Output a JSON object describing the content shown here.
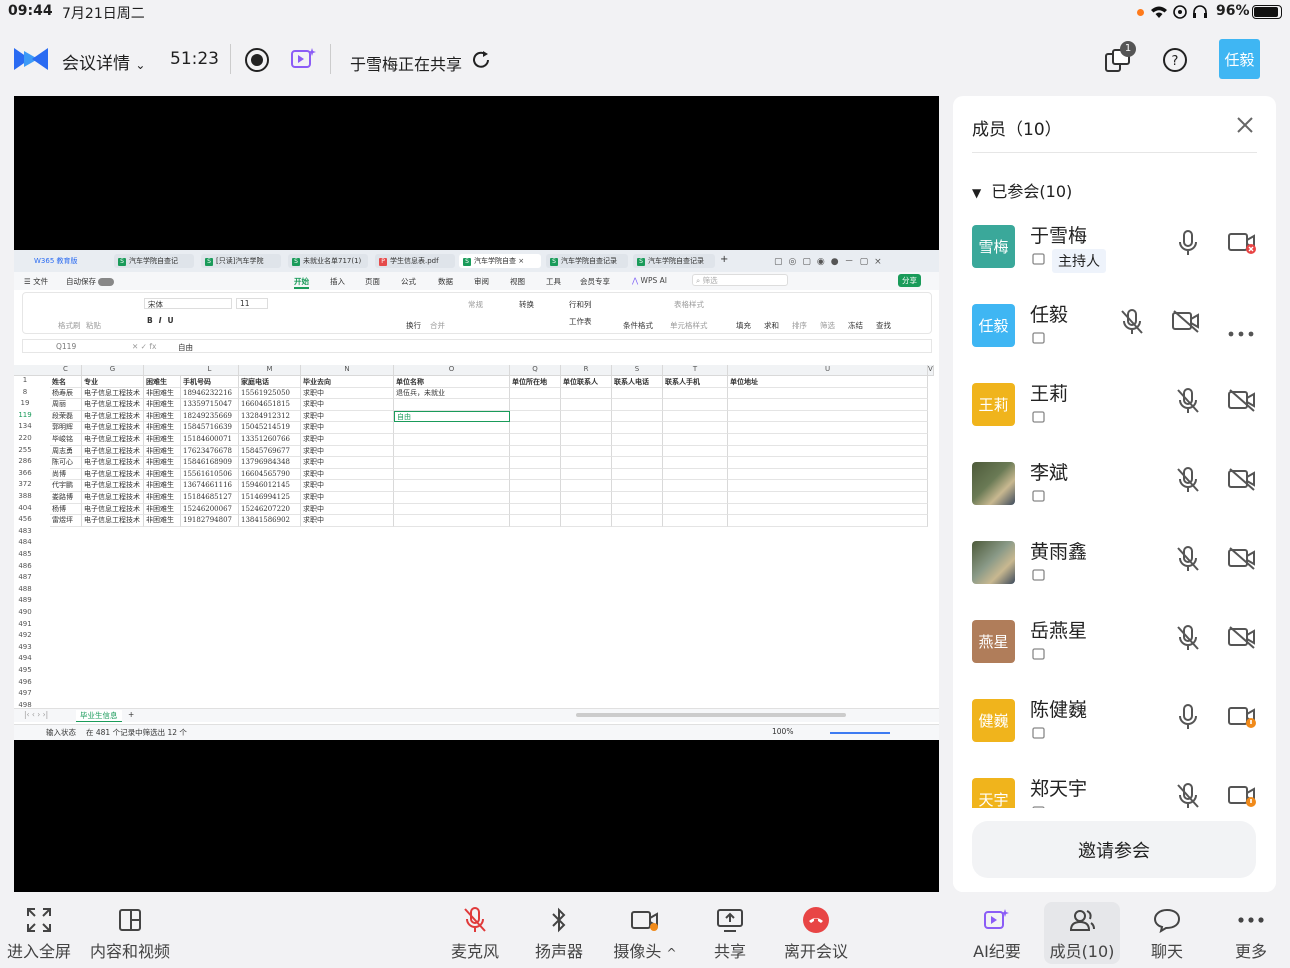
{
  "status_bar": {
    "time": "09:44",
    "date": "7月21日周二",
    "battery": "96%"
  },
  "topbar": {
    "meeting_details": "会议详情",
    "timer": "51:23",
    "sharing_text": "于雪梅正在共享",
    "layout_badge": "1",
    "user_avatar": "任毅",
    "colors": {
      "brand": "#2a6bf2",
      "avatar": "#3fb6f3",
      "purple": "#8b5cf6"
    }
  },
  "excel": {
    "tabs": [
      "W365 教育版",
      "汽车学院自查记",
      "[只读]汽车学院",
      "未就业名单717(1)",
      "学生信息表.pdf",
      "汽车学院自查",
      "汽车学院自查记录",
      "汽车学院自查记录"
    ],
    "menu": [
      "文件",
      "自动保存",
      "开始",
      "插入",
      "页面",
      "公式",
      "数据",
      "审阅",
      "视图",
      "工具",
      "会员专享",
      "WPS AI",
      "筛选",
      "分享"
    ],
    "ribbon": [
      "格式刷",
      "粘贴",
      "宋体",
      "11",
      "换行",
      "合并",
      "常规",
      "转换",
      "行和列",
      "工作表",
      "条件格式",
      "单元格样式",
      "表格样式",
      "填充",
      "求和",
      "排序",
      "筛选",
      "冻结",
      "查找"
    ],
    "name_box": "Q119",
    "formula": "自由",
    "col_letters": [
      "C",
      "G",
      "L",
      "M",
      "N",
      "O",
      "Q",
      "R",
      "S",
      "T",
      "U",
      "V"
    ],
    "headers": [
      "姓名",
      "专业",
      "困难生",
      "手机号码",
      "家庭电话",
      "毕业去向",
      "单位名称",
      "单位所在地",
      "单位联系人",
      "联系人电话",
      "联系人手机",
      "单位地址"
    ],
    "rows": [
      {
        "n": "1",
        "c": []
      },
      {
        "n": "8",
        "c": [
          "杨寿辰",
          "电子信息工程技术",
          "非困难生",
          "18946232216",
          "15561925050",
          "求职中",
          "退伍兵，未就业"
        ]
      },
      {
        "n": "19",
        "c": [
          "周丽",
          "电子信息工程技术",
          "非困难生",
          "13359715047",
          "16604651815",
          "求职中",
          ""
        ]
      },
      {
        "n": "119",
        "c": [
          "段荣磊",
          "电子信息工程技术",
          "非困难生",
          "18249235669",
          "13284912312",
          "求职中",
          "自由"
        ]
      },
      {
        "n": "134",
        "c": [
          "郭明辉",
          "电子信息工程技术",
          "非困难生",
          "15845716639",
          "15045214519",
          "求职中",
          ""
        ]
      },
      {
        "n": "220",
        "c": [
          "毕峻铭",
          "电子信息工程技术",
          "非困难生",
          "15184600071",
          "13351260766",
          "求职中",
          ""
        ]
      },
      {
        "n": "255",
        "c": [
          "周志勇",
          "电子信息工程技术",
          "非困难生",
          "17623476678",
          "15845769677",
          "求职中",
          ""
        ]
      },
      {
        "n": "286",
        "c": [
          "陈可心",
          "电子信息工程技术",
          "非困难生",
          "15846168909",
          "13796984348",
          "求职中",
          ""
        ]
      },
      {
        "n": "366",
        "c": [
          "尚博",
          "电子信息工程技术",
          "非困难生",
          "15561610506",
          "16604565790",
          "求职中",
          ""
        ]
      },
      {
        "n": "372",
        "c": [
          "代宇鹏",
          "电子信息工程技术",
          "非困难生",
          "13674661116",
          "15946012145",
          "求职中",
          ""
        ]
      },
      {
        "n": "388",
        "c": [
          "娄路博",
          "电子信息工程技术",
          "非困难生",
          "15184685127",
          "15146994125",
          "求职中",
          ""
        ]
      },
      {
        "n": "404",
        "c": [
          "杨博",
          "电子信息工程技术",
          "非困难生",
          "15246200067",
          "15246207220",
          "求职中",
          ""
        ]
      },
      {
        "n": "456",
        "c": [
          "雷煜坪",
          "电子信息工程技术",
          "非困难生",
          "19182794807",
          "13841586902",
          "求职中",
          ""
        ]
      },
      {
        "n": "483",
        "c": []
      },
      {
        "n": "484",
        "c": []
      },
      {
        "n": "485",
        "c": []
      },
      {
        "n": "486",
        "c": []
      },
      {
        "n": "487",
        "c": []
      },
      {
        "n": "488",
        "c": []
      },
      {
        "n": "489",
        "c": []
      },
      {
        "n": "490",
        "c": []
      },
      {
        "n": "491",
        "c": []
      },
      {
        "n": "492",
        "c": []
      },
      {
        "n": "493",
        "c": []
      },
      {
        "n": "494",
        "c": []
      },
      {
        "n": "495",
        "c": []
      },
      {
        "n": "496",
        "c": []
      },
      {
        "n": "497",
        "c": []
      },
      {
        "n": "498",
        "c": []
      },
      {
        "n": "499",
        "c": []
      }
    ],
    "sheet_tab": "毕业生信息",
    "status_left": "输入状态",
    "status_filter": "在 481 个记录中筛选出 12 个",
    "zoom": "100%"
  },
  "panel": {
    "title": "成员（10）",
    "section": "已参会(10)",
    "host_label": "主持人",
    "invite": "邀请参会",
    "members": [
      {
        "name": "于雪梅",
        "avatar_text": "雪梅",
        "color": "#3aa89a",
        "mic": "on",
        "cam": "off-red"
      },
      {
        "name": "任毅",
        "avatar_text": "任毅",
        "color": "#3fb6f3",
        "mic": "muted",
        "cam": "off"
      },
      {
        "name": "王莉",
        "avatar_text": "王莉",
        "color": "#f0b41c",
        "mic": "muted",
        "cam": "off"
      },
      {
        "name": "李斌",
        "avatar_text": "",
        "color": "#6a7a55",
        "mic": "muted",
        "cam": "off"
      },
      {
        "name": "黄雨鑫",
        "avatar_text": "",
        "color": "#8a9a88",
        "mic": "muted",
        "cam": "off"
      },
      {
        "name": "岳燕星",
        "avatar_text": "燕星",
        "color": "#b07d5a",
        "mic": "muted",
        "cam": "off"
      },
      {
        "name": "陈健巍",
        "avatar_text": "健巍",
        "color": "#f0b41c",
        "mic": "on",
        "cam": "off-orange"
      },
      {
        "name": "郑天宇",
        "avatar_text": "天宇",
        "color": "#f0b41c",
        "mic": "muted",
        "cam": "off-orange"
      }
    ]
  },
  "bottombar": {
    "fullscreen": "进入全屏",
    "content_video": "内容和视频",
    "mic": "麦克风",
    "speaker": "扬声器",
    "camera": "摄像头",
    "share": "共享",
    "leave": "离开会议",
    "ai_minutes": "AI纪要",
    "members": "成员(10)",
    "chat": "聊天",
    "more": "更多"
  }
}
